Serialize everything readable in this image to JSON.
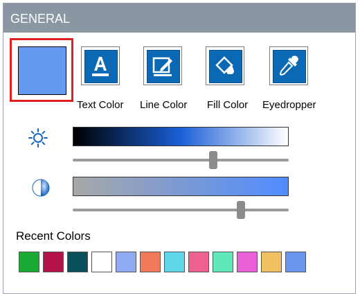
{
  "panel": {
    "title": "GENERAL"
  },
  "current_color": "#6699f0",
  "tools": [
    {
      "label": "Text Color",
      "icon": "text-color-icon"
    },
    {
      "label": "Line Color",
      "icon": "line-color-icon"
    },
    {
      "label": "Fill Color",
      "icon": "fill-color-icon"
    },
    {
      "label": "Eyedropper",
      "icon": "eyedropper-icon"
    }
  ],
  "brightness": {
    "icon": "brightness-sun-icon",
    "gradient": [
      "#000000",
      "#1a5fd6",
      "#ffffff"
    ],
    "value": 0.65
  },
  "saturation": {
    "icon": "contrast-icon",
    "gradient": [
      "#a8a8a8",
      "#4f8cff"
    ],
    "value": 0.78
  },
  "recent": {
    "label": "Recent Colors",
    "colors": [
      "#1aaa35",
      "#b3124a",
      "#0a4f5a",
      "#ffffff",
      "#8eaaf0",
      "#f07a5a",
      "#5fd6ea",
      "#f06090",
      "#60e8b8",
      "#ea60d8",
      "#eec060",
      "#6a96f0"
    ]
  }
}
